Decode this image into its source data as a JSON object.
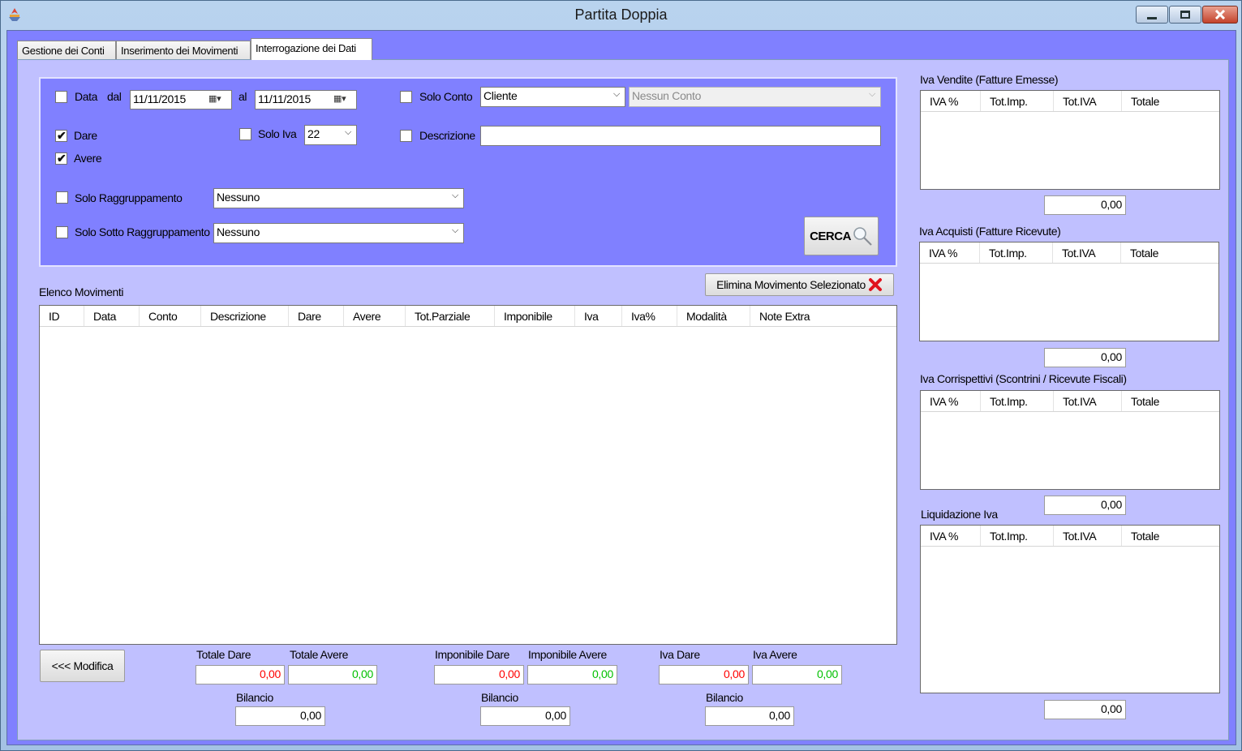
{
  "window": {
    "title": "Partita Doppia"
  },
  "tabs": [
    {
      "label": "Gestione dei Conti"
    },
    {
      "label": "Inserimento dei Movimenti"
    },
    {
      "label": "Interrogazione dei Dati",
      "active": true
    }
  ],
  "filters": {
    "data_label": "Data",
    "dal_label": "dal",
    "date_from": "11/11/2015",
    "al_label": "al",
    "date_to": "11/11/2015",
    "solo_conto_label": "Solo Conto",
    "conto_type": "Cliente",
    "conto_value": "Nessun Conto",
    "dare_label": "Dare",
    "avere_label": "Avere",
    "solo_iva_label": "Solo Iva",
    "iva_value": "22",
    "descrizione_label": "Descrizione",
    "descrizione_value": "",
    "solo_raggruppamento_label": "Solo Raggruppamento",
    "raggruppamento_value": "Nessuno",
    "solo_sotto_raggruppamento_label": "Solo Sotto Raggruppamento",
    "sotto_raggruppamento_value": "Nessuno",
    "cerca_label": "CERCA",
    "checks": {
      "data": false,
      "solo_conto": false,
      "dare": true,
      "avere": true,
      "solo_iva": false,
      "descrizione": false,
      "solo_raggruppamento": false,
      "solo_sotto_raggruppamento": false
    }
  },
  "movimenti": {
    "title": "Elenco Movimenti",
    "delete_label": "Elimina Movimento Selezionato",
    "columns": [
      "ID",
      "Data",
      "Conto",
      "Descrizione",
      "Dare",
      "Avere",
      "Tot.Parziale",
      "Imponibile",
      "Iva",
      "Iva%",
      "Modalità",
      "Note Extra"
    ],
    "rows": []
  },
  "totals": {
    "modifica_label": "<<< Modifica",
    "totale_dare_label": "Totale Dare",
    "totale_dare": "0,00",
    "totale_avere_label": "Totale Avere",
    "totale_avere": "0,00",
    "imponibile_dare_label": "Imponibile Dare",
    "imponibile_dare": "0,00",
    "imponibile_avere_label": "Imponibile Avere",
    "imponibile_avere": "0,00",
    "iva_dare_label": "Iva Dare",
    "iva_dare": "0,00",
    "iva_avere_label": "Iva Avere",
    "iva_avere": "0,00",
    "bilancio_label": "Bilancio",
    "bilancio_totale": "0,00",
    "bilancio_imponibile": "0,00",
    "bilancio_iva": "0,00"
  },
  "iva_columns": [
    "IVA %",
    "Tot.Imp.",
    "Tot.IVA",
    "Totale"
  ],
  "iva_sections": {
    "vendite": {
      "title": "Iva Vendite (Fatture Emesse)",
      "total": "0,00"
    },
    "acquisti": {
      "title": "Iva Acquisti (Fatture Ricevute)",
      "total": "0,00"
    },
    "corrispettivi": {
      "title": "Iva Corrispettivi (Scontrini / Ricevute Fiscali)",
      "total": "0,00"
    },
    "liquidazione": {
      "title": "Liquidazione Iva",
      "total": "0,00"
    }
  },
  "colors": {
    "panel": "#8080ff",
    "page": "#c0c0ff",
    "negative": "#ff0000",
    "positive": "#00c000"
  }
}
